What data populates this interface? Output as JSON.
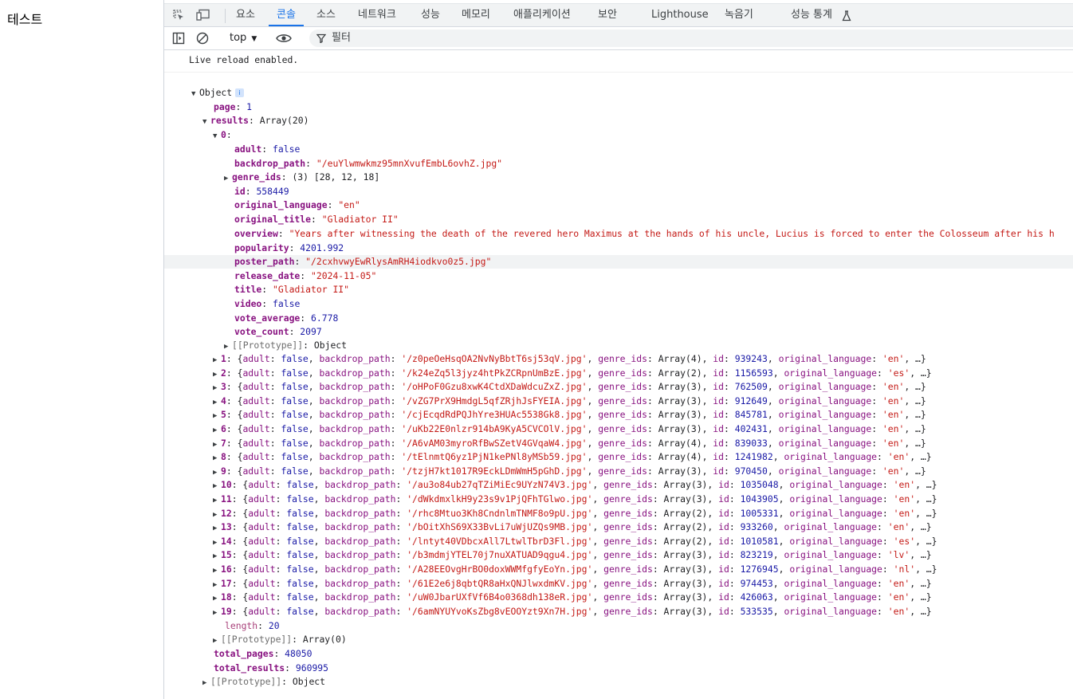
{
  "page": {
    "heading": "테스트"
  },
  "tabs": [
    "요소",
    "콘솔",
    "소스",
    "네트워크",
    "성능",
    "메모리",
    "애플리케이션",
    "보안",
    "Lighthouse",
    "녹음기",
    "성능 통계"
  ],
  "active_tab": "콘솔",
  "toolbar": {
    "context": "top",
    "filter_label": "필터"
  },
  "console": {
    "message": "Live reload enabled.",
    "obj_label": "Object",
    "page_key": "page",
    "page_value": "1",
    "results_key": "results",
    "results_desc": "Array(20)",
    "item0_index": "0",
    "item0": [
      {
        "key": "adult",
        "value": "false",
        "type": "b"
      },
      {
        "key": "backdrop_path",
        "value": "\"/euYlwmwkmz95mnXvufEmbL6ovhZ.jpg\"",
        "type": "s"
      },
      {
        "key": "genre_ids",
        "value": "(3) [28, 12, 18]",
        "type": "arr"
      },
      {
        "key": "id",
        "value": "558449",
        "type": "n"
      },
      {
        "key": "original_language",
        "value": "\"en\"",
        "type": "s"
      },
      {
        "key": "original_title",
        "value": "\"Gladiator II\"",
        "type": "s"
      },
      {
        "key": "overview",
        "value": "\"Years after witnessing the death of the revered hero Maximus at the hands of his uncle, Lucius is forced to enter the Colosseum after his h",
        "type": "s"
      },
      {
        "key": "popularity",
        "value": "4201.992",
        "type": "n"
      },
      {
        "key": "poster_path",
        "value": "\"/2cxhvwyEwRlysAmRH4iodkvo0z5.jpg\"",
        "type": "s"
      },
      {
        "key": "release_date",
        "value": "\"2024-11-05\"",
        "type": "s"
      },
      {
        "key": "title",
        "value": "\"Gladiator II\"",
        "type": "s"
      },
      {
        "key": "video",
        "value": "false",
        "type": "b"
      },
      {
        "key": "vote_average",
        "value": "6.778",
        "type": "n"
      },
      {
        "key": "vote_count",
        "value": "2097",
        "type": "n"
      }
    ],
    "proto_key": "[[Prototype]]",
    "proto_object": "Object",
    "proto_array": "Array(0)",
    "rows": [
      {
        "idx": "1",
        "bp": "'/z0peOeHsqOA2NvNyBbtT6sj53qV.jpg'",
        "g": "Array(4)",
        "id": "939243",
        "lang": "'en'"
      },
      {
        "idx": "2",
        "bp": "'/k24eZq5l3jyz4htPkZCRpnUmBzE.jpg'",
        "g": "Array(2)",
        "id": "1156593",
        "lang": "'es'"
      },
      {
        "idx": "3",
        "bp": "'/oHPoF0Gzu8xwK4CtdXDaWdcuZxZ.jpg'",
        "g": "Array(3)",
        "id": "762509",
        "lang": "'en'"
      },
      {
        "idx": "4",
        "bp": "'/vZG7PrX9HmdgL5qfZRjhJsFYEIA.jpg'",
        "g": "Array(3)",
        "id": "912649",
        "lang": "'en'"
      },
      {
        "idx": "5",
        "bp": "'/cjEcqdRdPQJhYre3HUAc5538Gk8.jpg'",
        "g": "Array(3)",
        "id": "845781",
        "lang": "'en'"
      },
      {
        "idx": "6",
        "bp": "'/uKb22E0nlzr914bA9KyA5CVCOlV.jpg'",
        "g": "Array(3)",
        "id": "402431",
        "lang": "'en'"
      },
      {
        "idx": "7",
        "bp": "'/A6vAM03myroRfBwSZetV4GVqaW4.jpg'",
        "g": "Array(4)",
        "id": "839033",
        "lang": "'en'"
      },
      {
        "idx": "8",
        "bp": "'/tElnmtQ6yz1PjN1kePNl8yMSb59.jpg'",
        "g": "Array(4)",
        "id": "1241982",
        "lang": "'en'"
      },
      {
        "idx": "9",
        "bp": "'/tzjH7kt1017R9EckLDmWmH5pGhD.jpg'",
        "g": "Array(3)",
        "id": "970450",
        "lang": "'en'"
      },
      {
        "idx": "10",
        "bp": "'/au3o84ub27qTZiMiEc9UYzN74V3.jpg'",
        "g": "Array(3)",
        "id": "1035048",
        "lang": "'en'"
      },
      {
        "idx": "11",
        "bp": "'/dWkdmxlkH9y23s9v1PjQFhTGlwo.jpg'",
        "g": "Array(3)",
        "id": "1043905",
        "lang": "'en'"
      },
      {
        "idx": "12",
        "bp": "'/rhc8Mtuo3Kh8CndnlmTNMF8o9pU.jpg'",
        "g": "Array(2)",
        "id": "1005331",
        "lang": "'en'"
      },
      {
        "idx": "13",
        "bp": "'/bOitXhS69X33BvLi7uWjUZQs9MB.jpg'",
        "g": "Array(2)",
        "id": "933260",
        "lang": "'en'"
      },
      {
        "idx": "14",
        "bp": "'/lntyt40VDbcxAll7LtwlTbrD3Fl.jpg'",
        "g": "Array(2)",
        "id": "1010581",
        "lang": "'es'"
      },
      {
        "idx": "15",
        "bp": "'/b3mdmjYTEL70j7nuXATUAD9qgu4.jpg'",
        "g": "Array(3)",
        "id": "823219",
        "lang": "'lv'"
      },
      {
        "idx": "16",
        "bp": "'/A28EEOvgHrBO0doxWWMfgfyEoYn.jpg'",
        "g": "Array(3)",
        "id": "1276945",
        "lang": "'nl'"
      },
      {
        "idx": "17",
        "bp": "'/61E2e6j8qbtQR8aHxQNJlwxdmKV.jpg'",
        "g": "Array(3)",
        "id": "974453",
        "lang": "'en'"
      },
      {
        "idx": "18",
        "bp": "'/uW0JbarUXfVf6B4o0368dh138eR.jpg'",
        "g": "Array(3)",
        "id": "426063",
        "lang": "'en'"
      },
      {
        "idx": "19",
        "bp": "'/6amNYUYvoKsZbg8vEOOYzt9Xn7H.jpg'",
        "g": "Array(3)",
        "id": "533535",
        "lang": "'en'"
      }
    ],
    "length_key": "length",
    "length_value": "20",
    "total_pages_key": "total_pages",
    "total_pages_value": "48050",
    "total_results_key": "total_results",
    "total_results_value": "960995"
  }
}
